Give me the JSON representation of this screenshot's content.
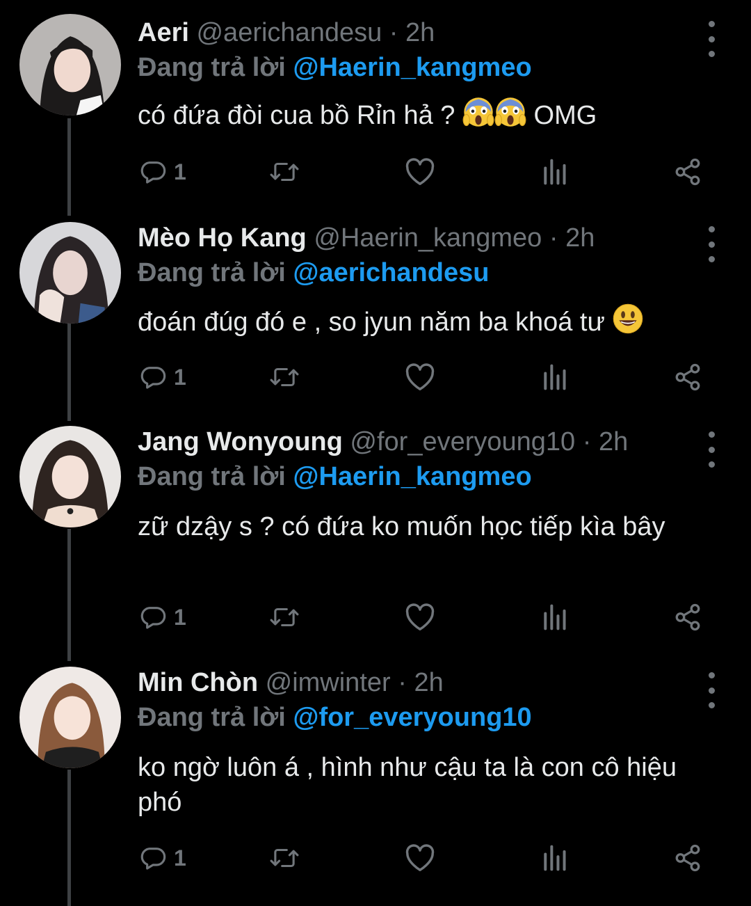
{
  "colors": {
    "background": "#000000",
    "text": "#e7e9ea",
    "muted": "#71767b",
    "link": "#1d9bf0",
    "thread_line": "#3e4144"
  },
  "reply_prefix": "Đang trả lời",
  "tweets": [
    {
      "name": "Aeri",
      "handle": "@aerichandesu",
      "dot": "·",
      "time": "2h",
      "reply_to": "@Haerin_kangmeo",
      "text_before": "có đứa đòi cua bồ Rỉn hả ?",
      "emoji": [
        "face-screaming-in-fear",
        "face-screaming-in-fear"
      ],
      "text_after": "OMG",
      "reply_count": "1"
    },
    {
      "name": "Mèo Họ Kang",
      "handle": "@Haerin_kangmeo",
      "dot": "·",
      "time": "2h",
      "reply_to": "@aerichandesu",
      "text_before": "đoán đúg đó e , so jyun năm ba khoá tư",
      "emoji": [
        "grinning-face"
      ],
      "text_after": "",
      "reply_count": "1"
    },
    {
      "name": "Jang Wonyoung",
      "handle": "@for_everyoung10",
      "dot": "·",
      "time": "2h",
      "reply_to": "@Haerin_kangmeo",
      "text_before": "zữ dzậy s ? có đứa ko muốn học tiếp kìa bây",
      "emoji": [],
      "text_after": "",
      "reply_count": "1"
    },
    {
      "name": "Min Chòn",
      "handle": "@imwinter",
      "dot": "·",
      "time": "2h",
      "reply_to": "@for_everyoung10",
      "text_before": "ko ngờ luôn á , hình như cậu ta là con cô hiệu phó",
      "emoji": [],
      "text_after": "",
      "reply_count": "1"
    }
  ],
  "icons": {
    "reply": "reply-icon",
    "retweet": "retweet-icon",
    "like": "heart-icon",
    "views": "views-icon",
    "share": "share-icon",
    "more": "more-vertical-icon"
  }
}
